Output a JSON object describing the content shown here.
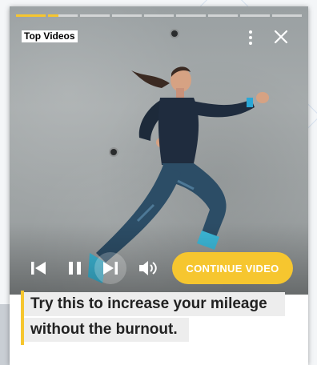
{
  "player": {
    "label": "Top Videos",
    "progress_segments": [
      1,
      0,
      0,
      0,
      0,
      0,
      0,
      0,
      0
    ],
    "continue_label": "CONTINUE VIDEO",
    "headline_line1": "Try this to increase your mileage",
    "headline_line2": "without the burnout."
  },
  "icons": {
    "menu": "more-vertical-icon",
    "close": "close-icon",
    "previous": "skip-previous-icon",
    "pause": "pause-icon",
    "next": "skip-next-icon",
    "volume": "volume-icon"
  },
  "colors": {
    "accent": "#f6c62f",
    "headline_bg": "#ededed",
    "headline_text": "#222222"
  }
}
